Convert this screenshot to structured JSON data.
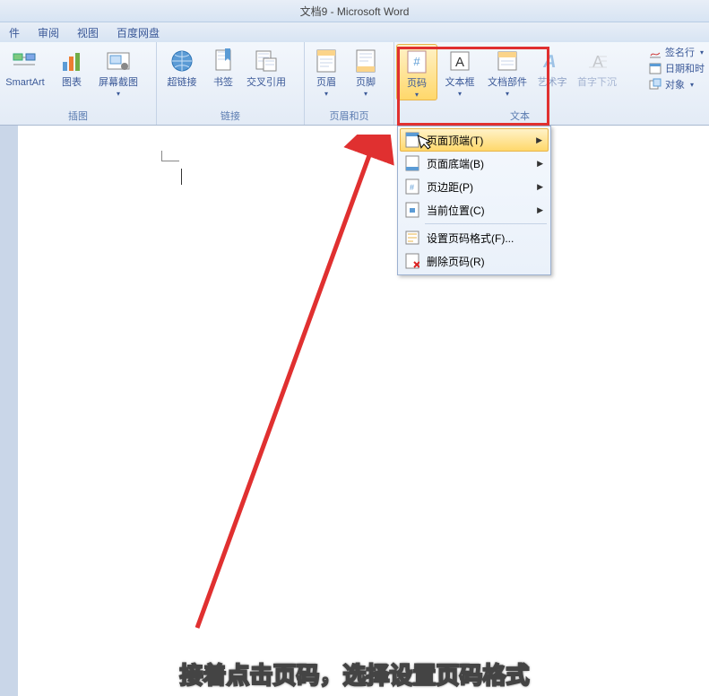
{
  "title": "文档9 - Microsoft Word",
  "tabs": {
    "t1": "件",
    "t2": "审阅",
    "t3": "视图",
    "t4": "百度网盘"
  },
  "ribbon": {
    "smartart": "SmartArt",
    "chart": "图表",
    "screenshot": "屏幕截图",
    "hyperlink": "超链接",
    "bookmark": "书签",
    "crossref": "交叉引用",
    "header": "页眉",
    "footer": "页脚",
    "pagenum": "页码",
    "textbox": "文本框",
    "quickparts": "文档部件",
    "wordart": "艺术字",
    "dropcap": "首字下沉",
    "sigline": "签名行",
    "datetime": "日期和时",
    "object": "对象"
  },
  "groups": {
    "illus": "插图",
    "links": "链接",
    "hf": "页眉和页",
    "text": "文本"
  },
  "menu": {
    "top": "页面顶端(T)",
    "bottom": "页面底端(B)",
    "margins": "页边距(P)",
    "current": "当前位置(C)",
    "format": "设置页码格式(F)...",
    "remove": "删除页码(R)"
  },
  "caption": "接着点击页码，选择设置页码格式"
}
